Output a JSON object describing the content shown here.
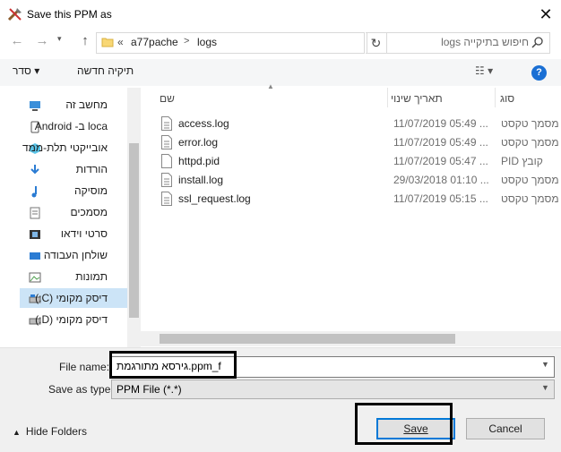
{
  "window": {
    "title": "Save this PPM as",
    "close_glyph": "✕"
  },
  "nav": {
    "back_glyph": "←",
    "forward_glyph": "→",
    "recent_glyph": "▾",
    "up_glyph": "↑",
    "breadcrumb": {
      "prefix": "«",
      "items": [
        "a77pache",
        "logs"
      ],
      "separator": ">"
    },
    "refresh_glyph": "↻",
    "search_placeholder": "חיפוש בתיקייה logs"
  },
  "toolbar": {
    "organize_label": "סדר ▾",
    "new_folder_label": "תיקיה חדשה",
    "view_glyph": "☷ ▾",
    "help_glyph": "?"
  },
  "sidebar": {
    "items": [
      {
        "label": "מחשב זה",
        "icon": "computer-icon"
      },
      {
        "label": "Android -ב loca",
        "icon": "phone-icon"
      },
      {
        "label": "אובייקטי תלת-ממד",
        "icon": "cube-icon"
      },
      {
        "label": "הורדות",
        "icon": "download-icon"
      },
      {
        "label": "מוסיקה",
        "icon": "music-icon"
      },
      {
        "label": "מסמכים",
        "icon": "documents-icon"
      },
      {
        "label": "סרטי וידאו",
        "icon": "video-icon"
      },
      {
        "label": "שולחן העבודה",
        "icon": "desktop-icon"
      },
      {
        "label": "תמונות",
        "icon": "pictures-icon"
      },
      {
        "label": "דיסק מקומי (C:)",
        "icon": "drive-icon"
      },
      {
        "label": "דיסק מקומי (D:)",
        "icon": "drive-icon"
      }
    ]
  },
  "file_list": {
    "columns": {
      "name": "שם",
      "date": "תאריך שינוי",
      "type": "סוג"
    },
    "rows": [
      {
        "name": "access.log",
        "date": "11/07/2019 05:49 ...",
        "type": "מסמך טקסט"
      },
      {
        "name": "error.log",
        "date": "11/07/2019 05:49 ...",
        "type": "מסמך טקסט"
      },
      {
        "name": "httpd.pid",
        "date": "11/07/2019 05:47 ...",
        "type": "קובץ PID"
      },
      {
        "name": "install.log",
        "date": "29/03/2018 01:10 ...",
        "type": "מסמך טקסט"
      },
      {
        "name": "ssl_request.log",
        "date": "11/07/2019 05:15 ...",
        "type": "מסמך טקסט"
      }
    ]
  },
  "form": {
    "file_name_label": "File name:",
    "file_name_value": "גירסא מתורגמת.ppm_f",
    "save_type_label": "Save as type:",
    "save_type_value": "PPM File (*.*)"
  },
  "buttons": {
    "hide_folders": "Hide Folders",
    "save": "Save",
    "cancel": "Cancel"
  },
  "colors": {
    "accent": "#0078d7",
    "selection": "#cce4f7",
    "help": "#1a6fd4"
  }
}
